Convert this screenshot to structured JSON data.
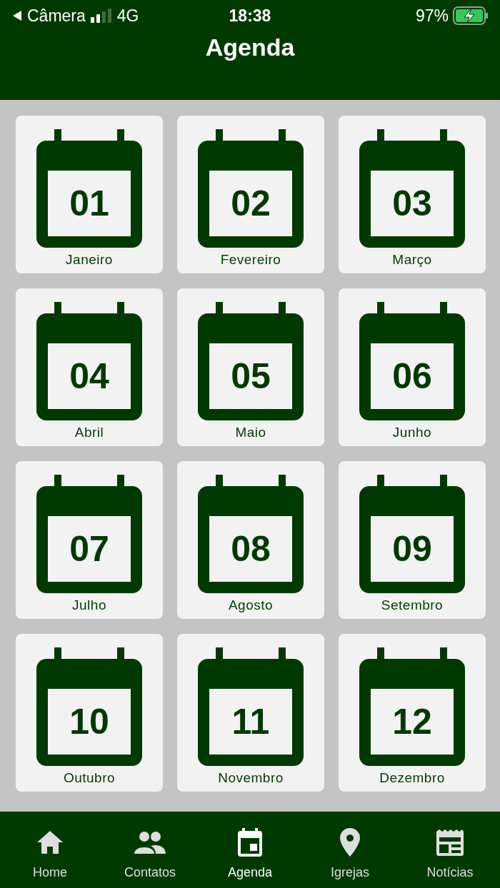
{
  "status_bar": {
    "back_app": "Câmera",
    "network": "4G",
    "time": "18:38",
    "battery": "97%"
  },
  "header": {
    "title": "Agenda"
  },
  "months": [
    {
      "number": "01",
      "name": "Janeiro"
    },
    {
      "number": "02",
      "name": "Fevereiro"
    },
    {
      "number": "03",
      "name": "Março"
    },
    {
      "number": "04",
      "name": "Abril"
    },
    {
      "number": "05",
      "name": "Maio"
    },
    {
      "number": "06",
      "name": "Junho"
    },
    {
      "number": "07",
      "name": "Julho"
    },
    {
      "number": "08",
      "name": "Agosto"
    },
    {
      "number": "09",
      "name": "Setembro"
    },
    {
      "number": "10",
      "name": "Outubro"
    },
    {
      "number": "11",
      "name": "Novembro"
    },
    {
      "number": "12",
      "name": "Dezembro"
    }
  ],
  "tab_bar": [
    {
      "label": "Home",
      "kind": "home",
      "selected": false
    },
    {
      "label": "Contatos",
      "kind": "contacts",
      "selected": false
    },
    {
      "label": "Agenda",
      "kind": "calendar",
      "selected": true
    },
    {
      "label": "Igrejas",
      "kind": "place",
      "selected": false
    },
    {
      "label": "Notícias",
      "kind": "news",
      "selected": false
    }
  ]
}
